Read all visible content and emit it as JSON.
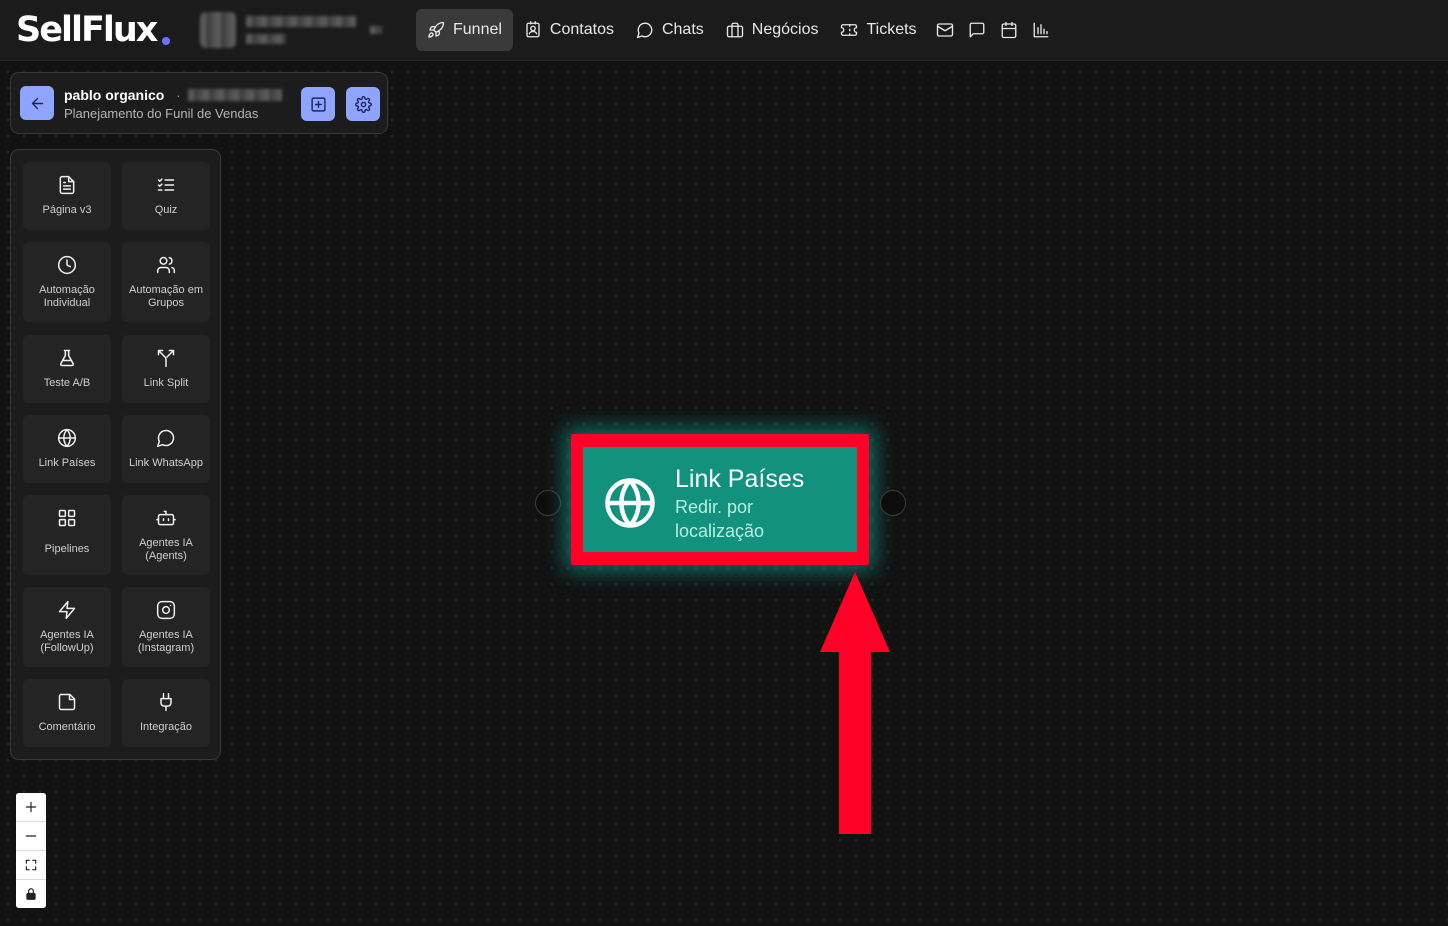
{
  "app": {
    "logo": "SellFlux"
  },
  "nav": {
    "items": [
      {
        "label": "Funnel",
        "icon": "rocket-icon",
        "active": true
      },
      {
        "label": "Contatos",
        "icon": "contact-icon"
      },
      {
        "label": "Chats",
        "icon": "chat-icon"
      },
      {
        "label": "Negócios",
        "icon": "briefcase-icon"
      },
      {
        "label": "Tickets",
        "icon": "ticket-icon"
      }
    ],
    "icon_buttons": [
      "mail-icon",
      "message-square-icon",
      "calendar-icon",
      "bar-chart-icon"
    ]
  },
  "flow_header": {
    "title": "pablo organico",
    "separator": "·",
    "subtitle": "Planejamento do Funil de Vendas"
  },
  "palette": {
    "tools": [
      {
        "label": "Página v3",
        "icon": "file-text-icon"
      },
      {
        "label": "Quiz",
        "icon": "list-checks-icon"
      },
      {
        "label": "Automação Individual",
        "icon": "clock-icon"
      },
      {
        "label": "Automação em Grupos",
        "icon": "users-icon"
      },
      {
        "label": "Teste A/B",
        "icon": "flask-icon"
      },
      {
        "label": "Link Split",
        "icon": "split-icon"
      },
      {
        "label": "Link Países",
        "icon": "globe-icon"
      },
      {
        "label": "Link WhatsApp",
        "icon": "whatsapp-icon"
      },
      {
        "label": "Pipelines",
        "icon": "grid-icon"
      },
      {
        "label": "Agentes IA (Agents)",
        "icon": "bot-icon"
      },
      {
        "label": "Agentes IA (FollowUp)",
        "icon": "zap-icon"
      },
      {
        "label": "Agentes IA (Instagram)",
        "icon": "instagram-icon"
      },
      {
        "label": "Comentário",
        "icon": "sticky-note-icon"
      },
      {
        "label": "Integração",
        "icon": "plug-icon"
      }
    ]
  },
  "zoom_controls": [
    "zoom-in-icon",
    "zoom-out-icon",
    "fit-view-icon",
    "lock-icon"
  ],
  "node": {
    "title": "Link Países",
    "subtitle": "Redir. por localização",
    "icon": "globe-icon",
    "color": "#12917f"
  },
  "colors": {
    "highlight": "#ff0026",
    "arrow": "#ff0026",
    "accent": "#8ea4ff"
  }
}
